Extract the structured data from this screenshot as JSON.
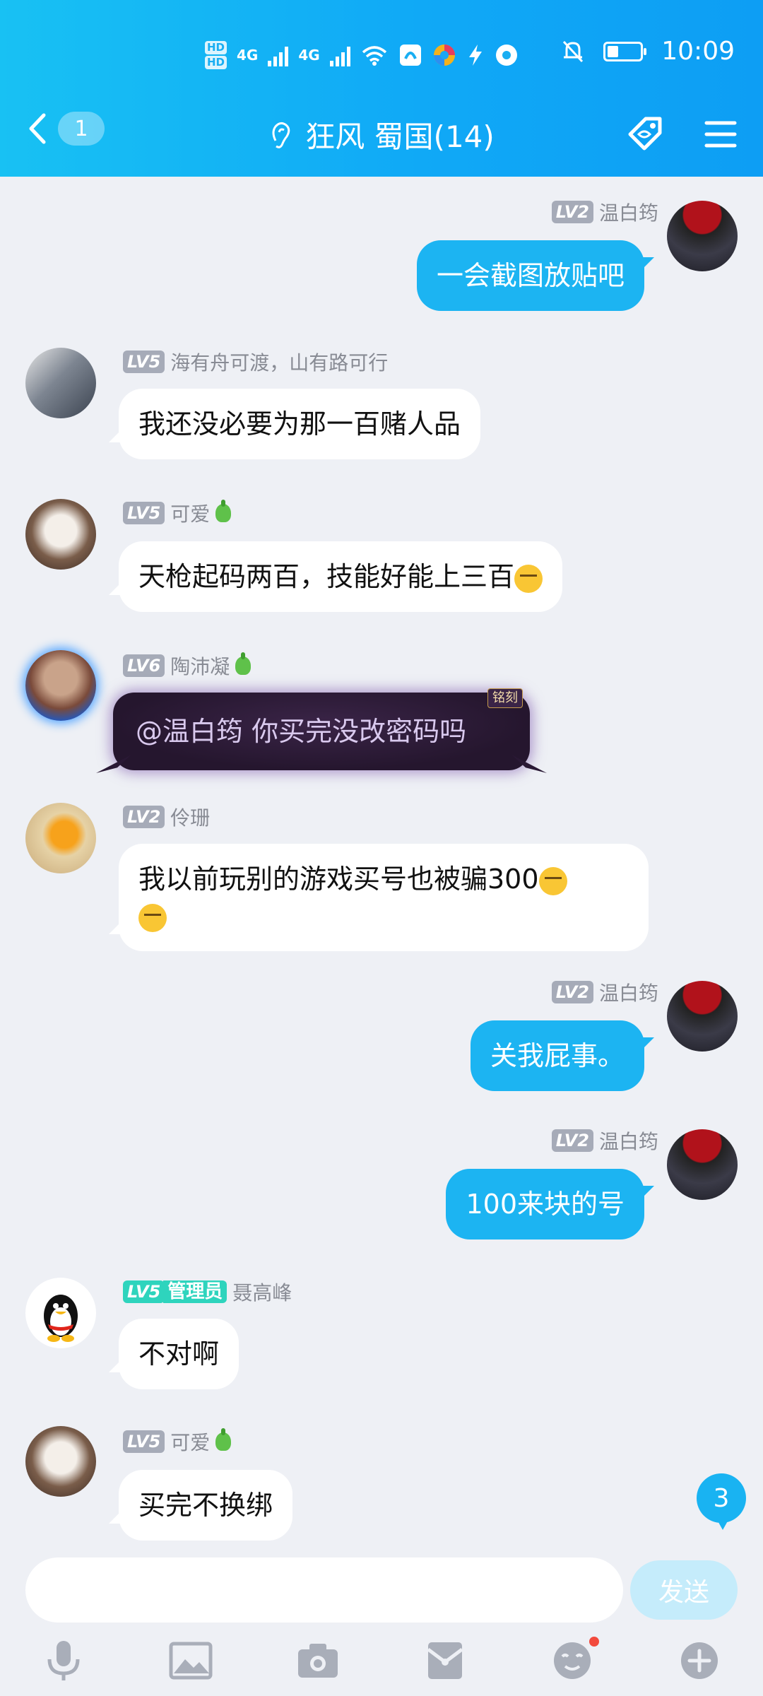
{
  "status_bar": {
    "hd1": "HD",
    "hd2": "HD",
    "net1": "4G",
    "net2": "4G",
    "time": "10:09",
    "battery_level": 0.35
  },
  "header": {
    "back_count": "1",
    "title": "狂风 蜀国(14)"
  },
  "messages": [
    {
      "side": "out",
      "level": "LV2",
      "name": "温白筠",
      "text": "一会截图放贴吧"
    },
    {
      "side": "in",
      "level": "LV5",
      "name": "海有舟可渡，山有路可行",
      "text": "我还没必要为那一百赌人品"
    },
    {
      "side": "in",
      "level": "LV5",
      "name": "可爱",
      "text": "天枪起码两百，技能好能上三百"
    },
    {
      "side": "in",
      "level": "LV6",
      "name": "陶沛凝",
      "text": "@温白筠 你买完没改密码吗",
      "tag": "铭刻"
    },
    {
      "side": "in",
      "level": "LV2",
      "name": "伶珊",
      "text": "我以前玩别的游戏买号也被骗300"
    },
    {
      "side": "out",
      "level": "LV2",
      "name": "温白筠",
      "text": "关我屁事。"
    },
    {
      "side": "out",
      "level": "LV2",
      "name": "温白筠",
      "text": "100来块的号"
    },
    {
      "side": "in",
      "level": "LV5",
      "role": "管理员",
      "name": "聂高峰",
      "text": "不对啊"
    },
    {
      "side": "in",
      "level": "LV5",
      "name": "可爱",
      "text": "买完不换绑"
    }
  ],
  "unread_count": "3",
  "input": {
    "placeholder": "",
    "send_label": "发送"
  },
  "toolbar_icons": [
    "microphone-icon",
    "image-icon",
    "camera-icon",
    "red-packet-icon",
    "emoji-icon",
    "plus-icon"
  ]
}
